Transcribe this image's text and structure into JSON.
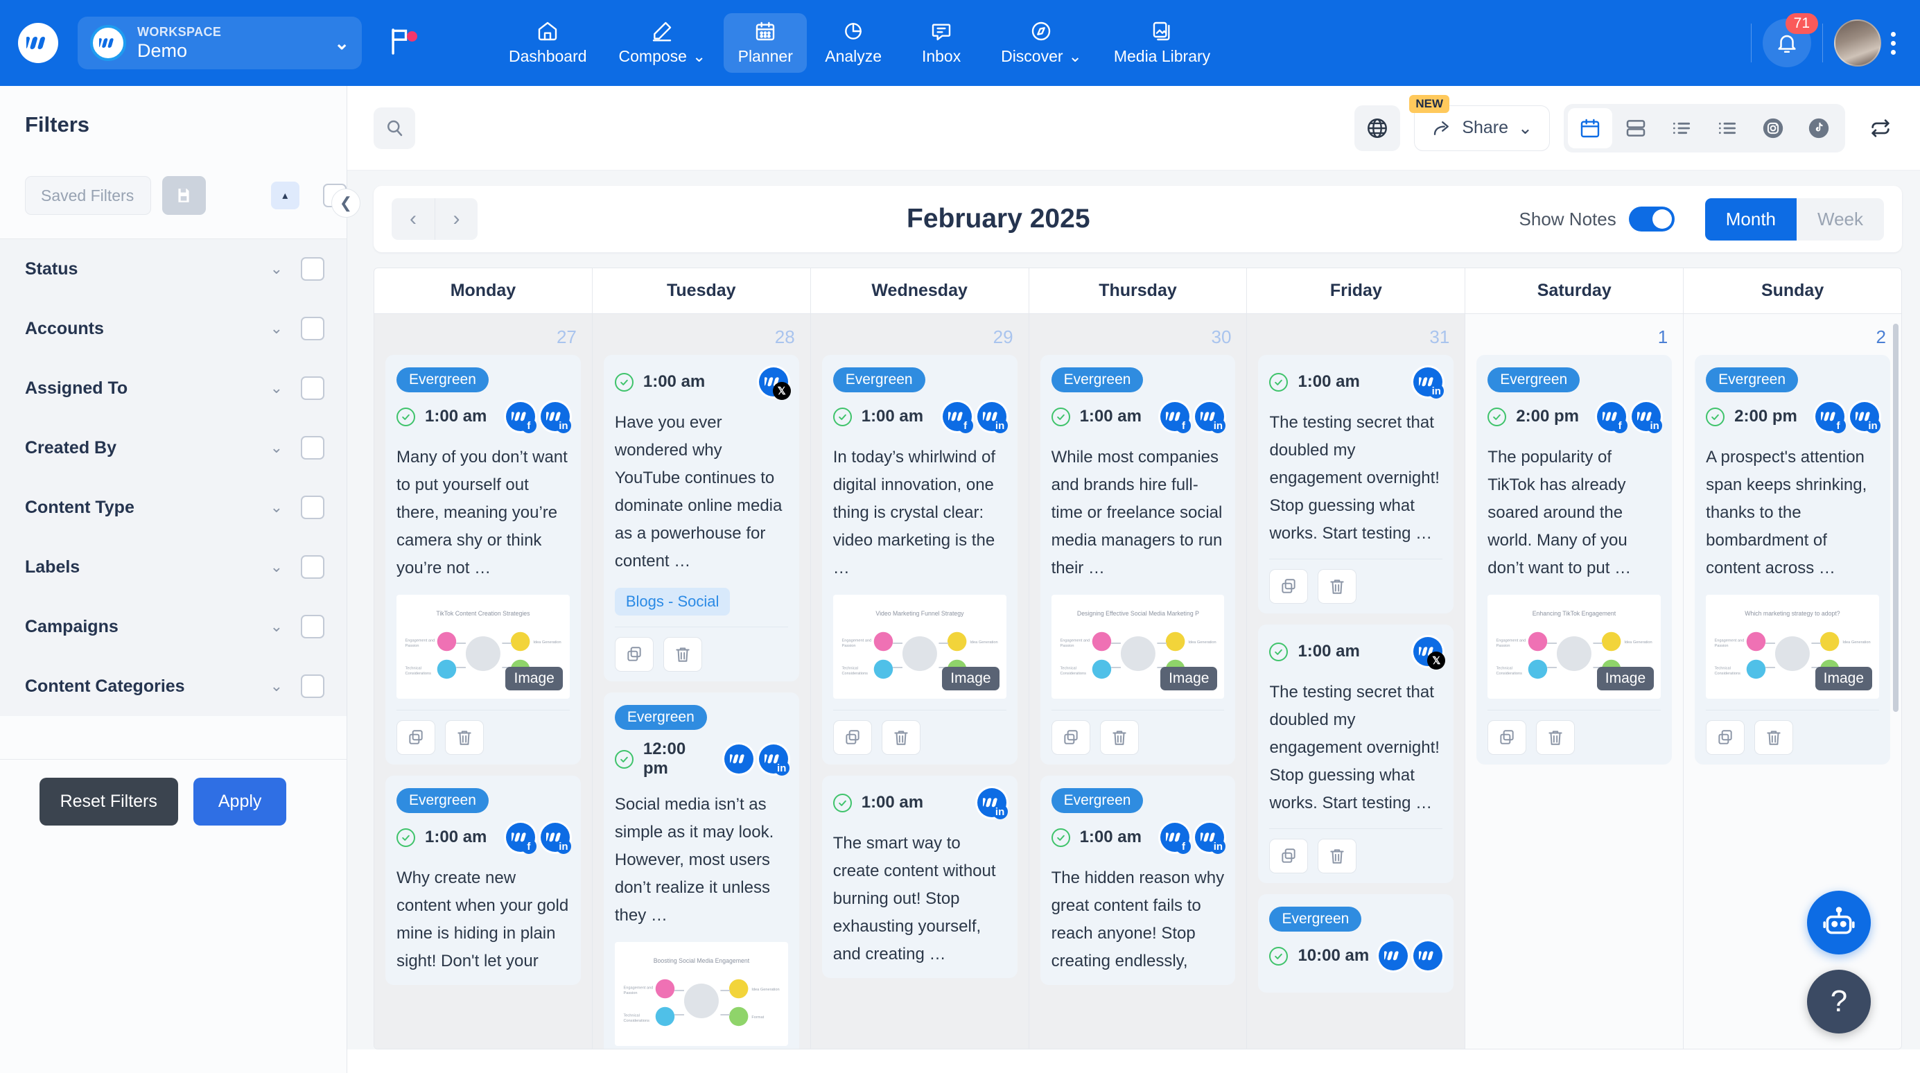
{
  "topnav": {
    "workspace_label": "WORKSPACE",
    "workspace_name": "Demo",
    "items": [
      {
        "label": "Dashboard",
        "icon": "home-icon",
        "active": false,
        "caret": false
      },
      {
        "label": "Compose",
        "icon": "pencil-icon",
        "active": false,
        "caret": true
      },
      {
        "label": "Planner",
        "icon": "calendar-icon",
        "active": true,
        "caret": false
      },
      {
        "label": "Analyze",
        "icon": "pie-chart-icon",
        "active": false,
        "caret": false
      },
      {
        "label": "Inbox",
        "icon": "chat-icon",
        "active": false,
        "caret": false
      },
      {
        "label": "Discover",
        "icon": "compass-icon",
        "active": false,
        "caret": true
      },
      {
        "label": "Media Library",
        "icon": "media-icon",
        "active": false,
        "caret": false
      }
    ],
    "notification_count": "71"
  },
  "sidebar": {
    "title": "Filters",
    "saved_filters_placeholder": "Saved Filters",
    "groups": [
      {
        "label": "Status"
      },
      {
        "label": "Accounts"
      },
      {
        "label": "Assigned To"
      },
      {
        "label": "Created By"
      },
      {
        "label": "Content Type"
      },
      {
        "label": "Labels"
      },
      {
        "label": "Campaigns"
      },
      {
        "label": "Content Categories"
      }
    ],
    "reset_label": "Reset Filters",
    "apply_label": "Apply"
  },
  "toolbar": {
    "share_label": "Share",
    "new_badge": "NEW",
    "views": [
      "calendar-view-icon",
      "board-view-icon",
      "list-view-icon",
      "feed-view-icon",
      "instagram-view-icon",
      "tiktok-view-icon"
    ],
    "active_view_index": 0
  },
  "monthbar": {
    "title": "February 2025",
    "show_notes_label": "Show Notes",
    "show_notes_on": true,
    "month_label": "Month",
    "week_label": "Week",
    "active_range": "Month"
  },
  "calendar": {
    "day_names": [
      "Monday",
      "Tuesday",
      "Wednesday",
      "Thursday",
      "Friday",
      "Saturday",
      "Sunday"
    ],
    "days": [
      {
        "number": "27",
        "current_month": false,
        "cards": [
          {
            "tag": "Evergreen",
            "time": "1:00 am",
            "accounts": [
              "facebook",
              "linkedin"
            ],
            "text": "Many of you don’t want to put yourself out there, meaning you’re camera shy or think you’re not …",
            "thumb_title": "TikTok Content Creation Strategies",
            "thumb_badge": "Image",
            "label": null,
            "has_actions": true
          },
          {
            "tag": "Evergreen",
            "time": "1:00 am",
            "accounts": [
              "facebook",
              "linkedin"
            ],
            "text": "Why create new content when your gold mine is hiding in plain sight! Don't let your",
            "thumb_title": null,
            "thumb_badge": null,
            "label": null,
            "has_actions": false
          }
        ]
      },
      {
        "number": "28",
        "current_month": false,
        "cards": [
          {
            "tag": null,
            "time": "1:00 am",
            "accounts": [
              "x"
            ],
            "text": "Have you ever wondered why YouTube continues to dominate online media as a powerhouse for content …",
            "thumb_title": null,
            "thumb_badge": null,
            "label": "Blogs - Social",
            "has_actions": true
          },
          {
            "tag": "Evergreen",
            "time": "12:00 pm",
            "accounts": [
              "plain",
              "linkedin"
            ],
            "text": "Social media isn’t as simple as it may look. However, most users don’t realize it unless they …",
            "thumb_title": "Boosting Social Media Engagement",
            "thumb_badge": null,
            "label": null,
            "has_actions": false
          }
        ]
      },
      {
        "number": "29",
        "current_month": false,
        "cards": [
          {
            "tag": "Evergreen",
            "time": "1:00 am",
            "accounts": [
              "facebook",
              "linkedin"
            ],
            "text": "In today’s whirlwind of digital innovation, one thing is crystal clear: video marketing is the …",
            "thumb_title": "Video Marketing Funnel Strategy",
            "thumb_badge": "Image",
            "label": null,
            "has_actions": true
          },
          {
            "tag": null,
            "time": "1:00 am",
            "accounts": [
              "linkedin"
            ],
            "text": "The smart way to create content without burning out! Stop exhausting yourself, and creating …",
            "thumb_title": null,
            "thumb_badge": null,
            "label": null,
            "has_actions": false
          }
        ]
      },
      {
        "number": "30",
        "current_month": false,
        "cards": [
          {
            "tag": "Evergreen",
            "time": "1:00 am",
            "accounts": [
              "facebook",
              "linkedin"
            ],
            "text": "While most companies and brands hire full-time or freelance social media managers to run their …",
            "thumb_title": "Designing Effective Social Media Marketing Packages",
            "thumb_badge": "Image",
            "label": null,
            "has_actions": true
          },
          {
            "tag": "Evergreen",
            "time": "1:00 am",
            "accounts": [
              "facebook",
              "linkedin"
            ],
            "text": "The hidden reason why great content fails to reach anyone! Stop creating endlessly,",
            "thumb_title": null,
            "thumb_badge": null,
            "label": null,
            "has_actions": false
          }
        ]
      },
      {
        "number": "31",
        "current_month": false,
        "cards": [
          {
            "tag": null,
            "time": "1:00 am",
            "accounts": [
              "linkedin"
            ],
            "text": "The testing secret that doubled my engagement overnight! Stop guessing what works. Start testing …",
            "thumb_title": null,
            "thumb_badge": null,
            "label": null,
            "has_actions": true
          },
          {
            "tag": null,
            "time": "1:00 am",
            "accounts": [
              "x"
            ],
            "text": "The testing secret that doubled my engagement overnight! Stop guessing what works. Start testing …",
            "thumb_title": null,
            "thumb_badge": null,
            "label": null,
            "has_actions": true
          },
          {
            "tag": "Evergreen",
            "time": "10:00 am",
            "accounts": [
              "plain",
              "plain"
            ],
            "text": "",
            "thumb_title": null,
            "thumb_badge": null,
            "label": null,
            "has_actions": false
          }
        ]
      },
      {
        "number": "1",
        "current_month": true,
        "cards": [
          {
            "tag": "Evergreen",
            "time": "2:00 pm",
            "accounts": [
              "facebook",
              "linkedin"
            ],
            "text": "The popularity of TikTok has already soared around the world. Many of you don’t want to put …",
            "thumb_title": "Enhancing TikTok Engagement",
            "thumb_badge": "Image",
            "label": null,
            "has_actions": true
          }
        ]
      },
      {
        "number": "2",
        "current_month": true,
        "cards": [
          {
            "tag": "Evergreen",
            "time": "2:00 pm",
            "accounts": [
              "facebook",
              "linkedin"
            ],
            "text": "A prospect's attention span keeps shrinking, thanks to the bombardment of content across …",
            "thumb_title": "Which marketing strategy to adopt?",
            "thumb_badge": "Image",
            "label": null,
            "has_actions": true
          }
        ]
      }
    ]
  },
  "colors": {
    "brand_blue": "#0d6ce4",
    "accent_green": "#3fc36b",
    "badge_red": "#fa5a5a",
    "new_yellow": "#ffc95c"
  }
}
